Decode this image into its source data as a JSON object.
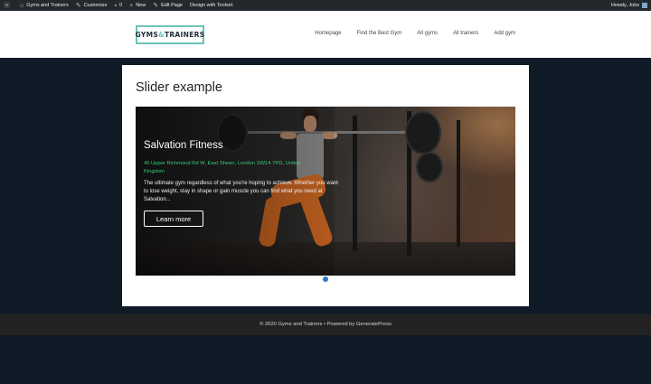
{
  "admin_bar": {
    "site_name": "Gyms and Trainers",
    "customize": "Customize",
    "comments_count": "0",
    "new": "New",
    "edit_page": "Edit Page",
    "design": "Design with Toolset",
    "greeting": "Howdy, Jobs"
  },
  "header": {
    "logo": {
      "part1": "GYMS",
      "amp": "&",
      "part2": "TRAINERS"
    },
    "nav": [
      "Homepage",
      "Find the Best Gym",
      "All gyms",
      "All trainers",
      "Add gym"
    ]
  },
  "page": {
    "title": "Slider example"
  },
  "slider": {
    "title": "Salvation Fitness",
    "address": "45 Upper Richmond Rd W, East Sheen, London SW14 7PD, United Kingdom",
    "description": "The ultimate gym regardless of what you're hoping to achieve. Whether you want to lose weight, stay in shape or gain muscle you can find what you need at Salvation...",
    "button_label": "Learn more",
    "active_dot_color": "#2c79c7"
  },
  "footer": {
    "text": "© 2020 Gyms and Trainers • Powered by GeneratePress"
  },
  "colors": {
    "admin_bar": "#23282d",
    "page_bg": "#0f1b26",
    "logo_accent": "#6cc3b6",
    "address_green": "#3ec97a",
    "footer_bg": "#222222"
  }
}
